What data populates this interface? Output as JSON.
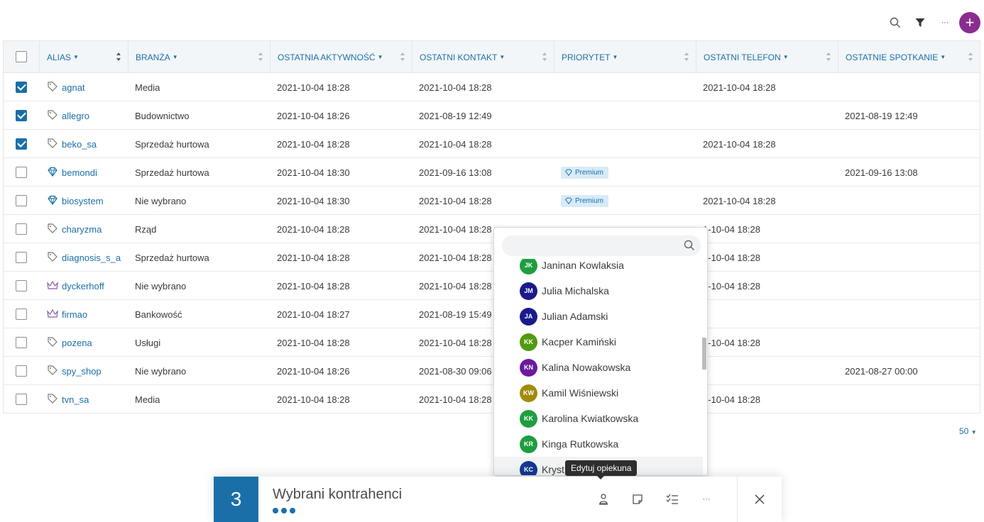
{
  "toolbar": {
    "search_icon": "search-icon",
    "filter_icon": "filter-icon",
    "more_label": "···",
    "add_label": "+"
  },
  "table": {
    "columns": [
      "ALIAS",
      "BRANŻA",
      "OSTATNIA AKTYWNOŚĆ",
      "OSTATNI KONTAKT",
      "PRIORYTET",
      "OSTATNI TELEFON",
      "OSTATNIE SPOTKANIE"
    ],
    "rows": [
      {
        "checked": true,
        "icon": "tag",
        "alias": "agnat",
        "branza": "Media",
        "aktywnosc": "2021-10-04 18:28",
        "kontakt": "2021-10-04 18:28",
        "priorytet": "",
        "telefon": "2021-10-04 18:28",
        "spotkanie": ""
      },
      {
        "checked": true,
        "icon": "tag",
        "alias": "allegro",
        "branza": "Budownictwo",
        "aktywnosc": "2021-10-04 18:26",
        "kontakt": "2021-08-19 12:49",
        "priorytet": "",
        "telefon": "",
        "spotkanie": "2021-08-19 12:49"
      },
      {
        "checked": true,
        "icon": "tag",
        "alias": "beko_sa",
        "branza": "Sprzedaż hurtowa",
        "aktywnosc": "2021-10-04 18:28",
        "kontakt": "2021-10-04 18:28",
        "priorytet": "",
        "telefon": "2021-10-04 18:28",
        "spotkanie": ""
      },
      {
        "checked": false,
        "icon": "diamond",
        "alias": "bemondi",
        "branza": "Sprzedaż hurtowa",
        "aktywnosc": "2021-10-04 18:30",
        "kontakt": "2021-09-16 13:08",
        "priorytet": "Premium",
        "telefon": "",
        "spotkanie": "2021-09-16 13:08"
      },
      {
        "checked": false,
        "icon": "diamond",
        "alias": "biosystem",
        "branza": "Nie wybrano",
        "aktywnosc": "2021-10-04 18:30",
        "kontakt": "2021-10-04 18:28",
        "priorytet": "Premium",
        "telefon": "2021-10-04 18:28",
        "spotkanie": ""
      },
      {
        "checked": false,
        "icon": "tag",
        "alias": "charyzma",
        "branza": "Rząd",
        "aktywnosc": "2021-10-04 18:28",
        "kontakt": "2021-10-04 18:28",
        "priorytet": "",
        "telefon": "1-10-04 18:28",
        "spotkanie": ""
      },
      {
        "checked": false,
        "icon": "tag",
        "alias": "diagnosis_s_a",
        "branza": "Sprzedaż hurtowa",
        "aktywnosc": "2021-10-04 18:28",
        "kontakt": "2021-10-04 18:28",
        "priorytet": "",
        "telefon": "1-10-04 18:28",
        "spotkanie": ""
      },
      {
        "checked": false,
        "icon": "crown",
        "alias": "dyckerhoff",
        "branza": "Nie wybrano",
        "aktywnosc": "2021-10-04 18:28",
        "kontakt": "2021-10-04 18:28",
        "priorytet": "",
        "telefon": "1-10-04 18:28",
        "spotkanie": ""
      },
      {
        "checked": false,
        "icon": "crown",
        "alias": "firmao",
        "branza": "Bankowość",
        "aktywnosc": "2021-10-04 18:27",
        "kontakt": "2021-08-19 15:49",
        "priorytet": "",
        "telefon": "",
        "spotkanie": ""
      },
      {
        "checked": false,
        "icon": "tag",
        "alias": "pozena",
        "branza": "Usługi",
        "aktywnosc": "2021-10-04 18:28",
        "kontakt": "2021-10-04 18:28",
        "priorytet": "",
        "telefon": "1-10-04 18:28",
        "spotkanie": ""
      },
      {
        "checked": false,
        "icon": "tag",
        "alias": "spy_shop",
        "branza": "Nie wybrano",
        "aktywnosc": "2021-10-04 18:26",
        "kontakt": "2021-08-30 09:06",
        "priorytet": "",
        "telefon": "",
        "spotkanie": "2021-08-27 00:00"
      },
      {
        "checked": false,
        "icon": "tag",
        "alias": "tvn_sa",
        "branza": "Media",
        "aktywnosc": "2021-10-04 18:28",
        "kontakt": "2021-10-04 18:28",
        "priorytet": "",
        "telefon": "1-10-04 18:28",
        "spotkanie": ""
      }
    ]
  },
  "dropdown": {
    "search_placeholder": "",
    "items": [
      {
        "initials": "JK",
        "name": "Janinan Kowlaksia",
        "color": "#1e9e3e"
      },
      {
        "initials": "JM",
        "name": "Julia Michalska",
        "color": "#1a1a8c"
      },
      {
        "initials": "JA",
        "name": "Julian Adamski",
        "color": "#1a1a8c"
      },
      {
        "initials": "KK",
        "name": "Kacper Kamiński",
        "color": "#4f9a0e"
      },
      {
        "initials": "KN",
        "name": "Kalina Nowakowska",
        "color": "#6a1b9a"
      },
      {
        "initials": "KW",
        "name": "Kamil Wiśniewski",
        "color": "#a18a0c"
      },
      {
        "initials": "KK",
        "name": "Karolina Kwiatkowska",
        "color": "#1e9e3e"
      },
      {
        "initials": "KR",
        "name": "Kinga Rutkowska",
        "color": "#1e9e3e"
      },
      {
        "initials": "KC",
        "name": "Kryst",
        "color": "#12398f"
      }
    ]
  },
  "tooltip": {
    "text": "Edytuj opiekuna"
  },
  "bottom_bar": {
    "count": "3",
    "title": "Wybrani kontrahenci",
    "more_label": "···"
  },
  "pager": {
    "label": "50"
  }
}
